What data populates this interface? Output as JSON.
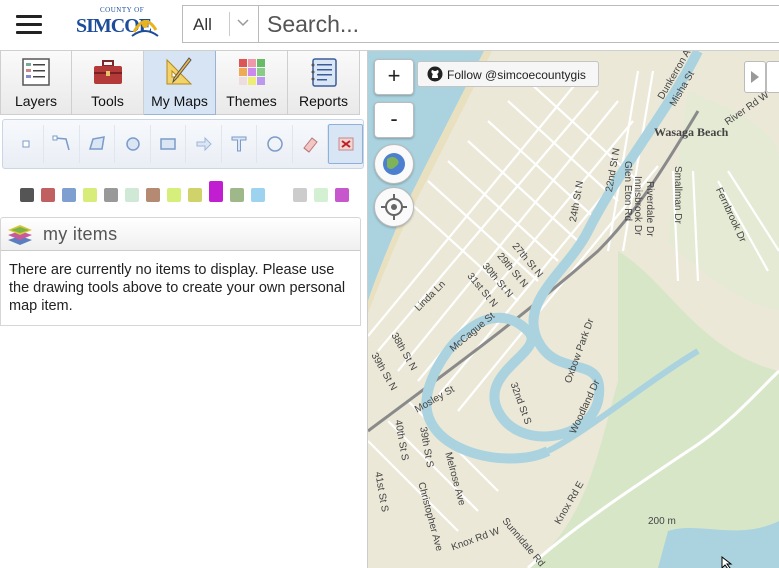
{
  "header": {
    "logo_county": "COUNTY OF",
    "logo_name": "SIMCOE",
    "filter_value": "All",
    "search_placeholder": "Search..."
  },
  "tabs": [
    {
      "label": "Layers",
      "icon": "layers-icon"
    },
    {
      "label": "Tools",
      "icon": "toolbox-icon"
    },
    {
      "label": "My Maps",
      "icon": "ruler-pencil-icon",
      "active": true
    },
    {
      "label": "Themes",
      "icon": "themes-grid-icon"
    },
    {
      "label": "Reports",
      "icon": "notebook-icon"
    }
  ],
  "draw_tools": [
    "point",
    "line",
    "polygon",
    "circle",
    "rectangle",
    "arrow",
    "text",
    "measure",
    "eraser",
    "delete"
  ],
  "colors": [
    "#555555",
    "#c06060",
    "#7f9fd0",
    "#d8ec7a",
    "#999999",
    "#cfe9d6",
    "#b48a72",
    "#d5ef7a",
    "#d0d36a",
    "#c21ed1",
    "#9fb88a",
    "#9ed3ef",
    "#ffffff",
    "#cccccc",
    "#d4f0d2",
    "#c657cc"
  ],
  "my_items": {
    "title": "my items",
    "message": "There are currently no items to display. Please use the drawing tools above to create your own personal map item."
  },
  "map": {
    "zoom_in": "+",
    "zoom_out": "-",
    "follow_label": "Follow @simcoecountygis",
    "town_label": "Wasaga Beach",
    "streets": [
      {
        "name": "Dunkerron Ave"
      },
      {
        "name": "Misha St"
      },
      {
        "name": "River Rd W"
      },
      {
        "name": "22nd St N"
      },
      {
        "name": "24th St N"
      },
      {
        "name": "27th St N"
      },
      {
        "name": "29th St N"
      },
      {
        "name": "30th St N"
      },
      {
        "name": "31st St N"
      },
      {
        "name": "Linda Ln"
      },
      {
        "name": "McCague St"
      },
      {
        "name": "Mosley St"
      },
      {
        "name": "32nd St S"
      },
      {
        "name": "Oxbow Park Dr"
      },
      {
        "name": "Woodland Dr"
      },
      {
        "name": "Knox Rd E"
      },
      {
        "name": "Knox Rd W"
      },
      {
        "name": "Sunnidale Rd"
      },
      {
        "name": "Melrose Ave"
      },
      {
        "name": "Christopher Ave"
      },
      {
        "name": "39th St S"
      },
      {
        "name": "40th St S"
      },
      {
        "name": "41st St S"
      },
      {
        "name": "38th St N"
      },
      {
        "name": "39th St N"
      },
      {
        "name": "Glen Eton Rd"
      },
      {
        "name": "Riverdale Dr"
      },
      {
        "name": "Innisbrook Dr"
      },
      {
        "name": "Smallman Dr"
      },
      {
        "name": "Fernbrook Dr"
      },
      {
        "name": "200 m"
      }
    ]
  }
}
